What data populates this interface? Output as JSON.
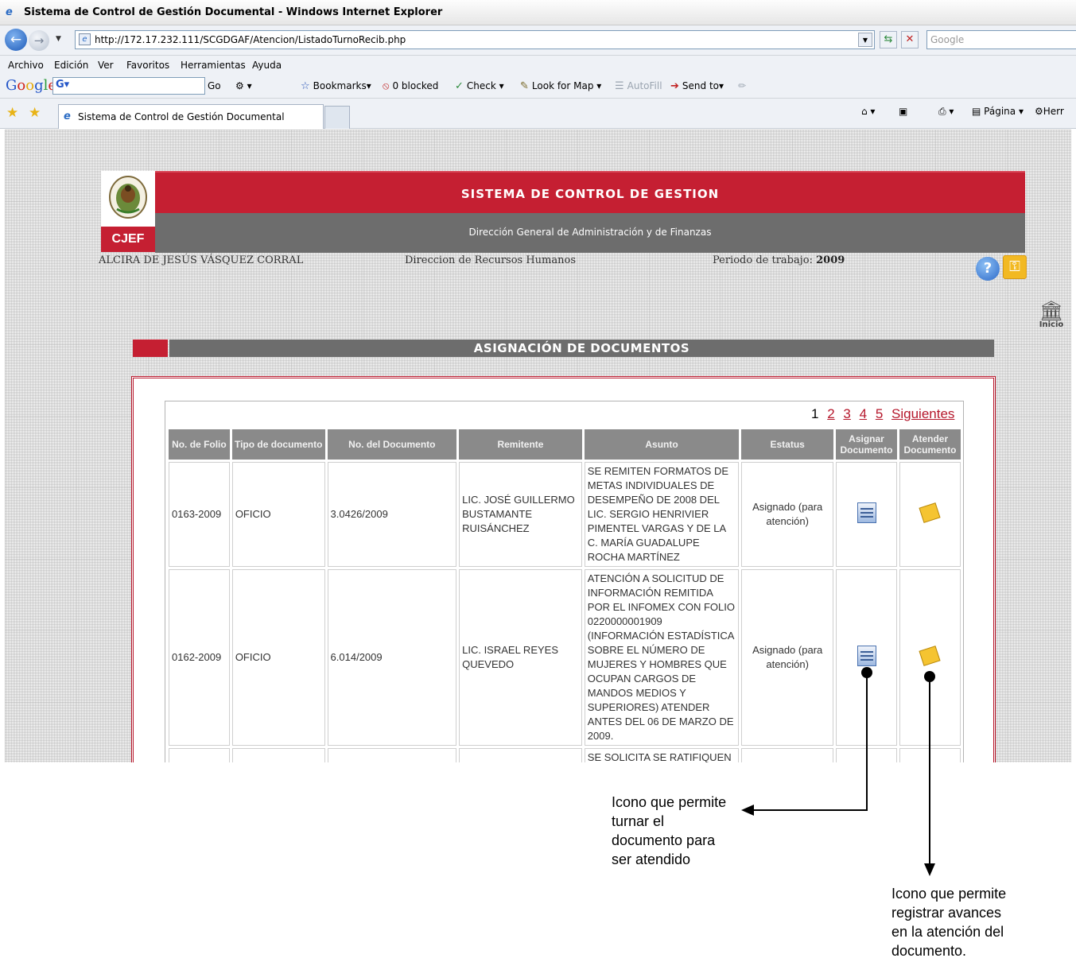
{
  "browser": {
    "window_title": "Sistema de Control de Gestión Documental - Windows Internet Explorer",
    "url": "http://172.17.232.111/SCGDGAF/Atencion/ListadoTurnoRecib.php",
    "search_placeholder": "Google",
    "menu": [
      "Archivo",
      "Edición",
      "Ver",
      "Favoritos",
      "Herramientas",
      "Ayuda"
    ],
    "google_toolbar": {
      "go": "Go",
      "bookmarks": "Bookmarks",
      "blocked": "0 blocked",
      "check": "Check",
      "look_for_map": "Look for Map",
      "autofill": "AutoFill",
      "send_to": "Send to"
    },
    "tab_title": "Sistema de Control de Gestión Documental",
    "command_bar": {
      "page": "Página",
      "tools": "Herr"
    }
  },
  "header": {
    "logo_text": "CJEF",
    "system_title": "SISTEMA DE CONTROL DE GESTION",
    "subtitle": "Dirección General de Administración y de Finanzas",
    "user": "ALCIRA DE JESÚS VÁSQUEZ CORRAL",
    "department": "Direccion de Recursos Humanos",
    "period_label": "Periodo de trabajo:",
    "period_value": "2009",
    "inicio": "Inicio"
  },
  "section_title": "ASIGNACIÓN DE DOCUMENTOS",
  "pager": {
    "current": "1",
    "pages": [
      "2",
      "3",
      "4",
      "5"
    ],
    "next": "Siguientes"
  },
  "table": {
    "headers": [
      "No. de Folio",
      "Tipo de documento",
      "No. del Documento",
      "Remitente",
      "Asunto",
      "Estatus",
      "Asignar Documento",
      "Atender Documento"
    ],
    "rows": [
      {
        "folio": "0163-2009",
        "tipo": "OFICIO",
        "numero": "3.0426/2009",
        "remitente": "LIC. JOSÉ GUILLERMO BUSTAMANTE RUISÁNCHEZ",
        "asunto": "SE REMITEN FORMATOS DE METAS INDIVIDUALES DE DESEMPEÑO DE 2008 DEL LIC. SERGIO HENRIVIER PIMENTEL VARGAS Y DE LA C. MARÍA GUADALUPE ROCHA MARTÍNEZ",
        "estatus": "Asignado (para atención)"
      },
      {
        "folio": "0162-2009",
        "tipo": "OFICIO",
        "numero": "6.014/2009",
        "remitente": "LIC. ISRAEL REYES QUEVEDO",
        "asunto": "ATENCIÓN A SOLICITUD DE INFORMACIÓN REMITIDA POR EL INFOMEX CON FOLIO 0220000001909 (INFORMACIÓN ESTADÍSTICA SOBRE EL NÚMERO DE MUJERES Y HOMBRES QUE OCUPAN CARGOS DE MANDOS MEDIOS Y SUPERIORES) ATENDER ANTES DEL 06 DE MARZO DE 2009.",
        "estatus": "Asignado (para atención)"
      },
      {
        "folio": "",
        "tipo": "",
        "numero": "",
        "remitente": "",
        "asunto": "SE SOLICITA SE RATIFIQUEN O MODIFIQUEN LOS DATOS",
        "estatus": ""
      }
    ]
  },
  "annotations": {
    "assign_note": "Icono que permite turnar el documento para ser atendido",
    "attend_note": "Icono que permite registrar avances en la atención del documento."
  },
  "colors": {
    "brand_red": "#c51f32",
    "header_gray": "#6d6d6d",
    "table_header": "#8a8a8a"
  }
}
